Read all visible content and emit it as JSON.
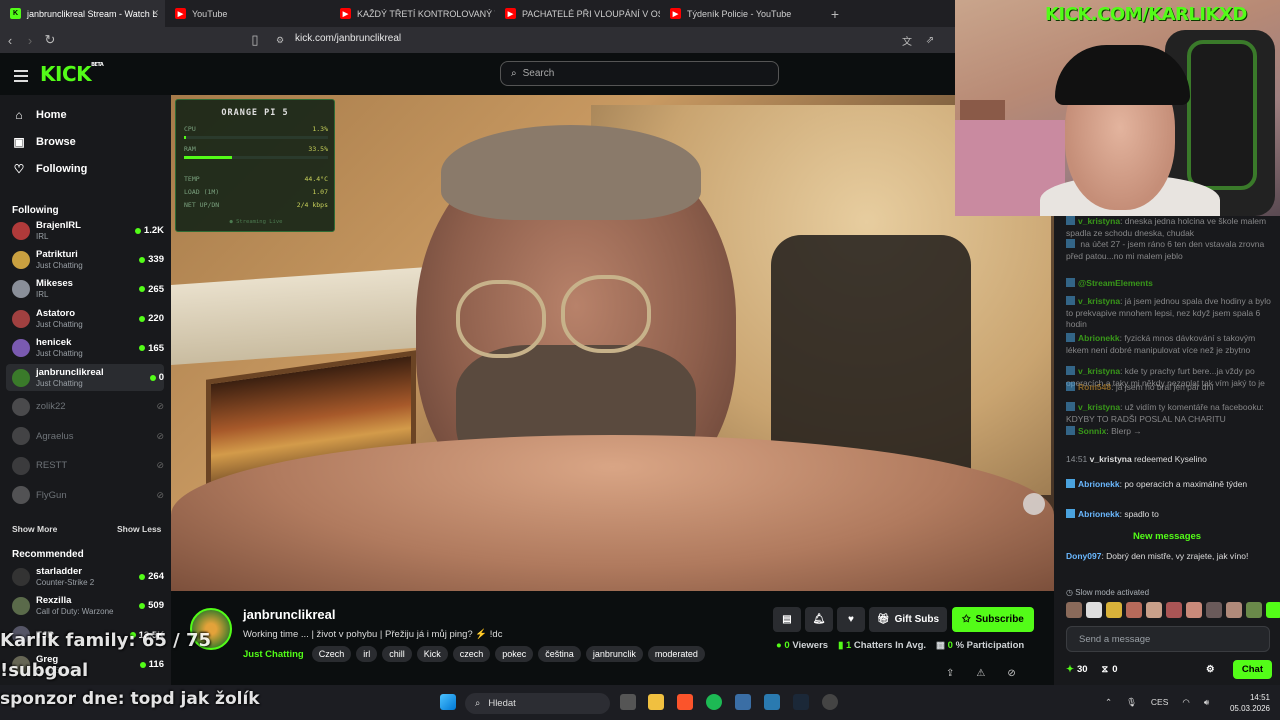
{
  "browser": {
    "tabs": [
      {
        "label": "janbrunclikreal Stream - Watch L",
        "active": true,
        "favicon": "K",
        "color": "#53fc18"
      },
      {
        "label": "YouTube",
        "active": false,
        "favicon": "▶",
        "color": "#ff0000"
      },
      {
        "label": "KAŽDÝ TŘETÍ KONTROLOVANÝ TAXI",
        "active": false,
        "favicon": "▶",
        "color": "#ff0000"
      },
      {
        "label": "PACHATELÉ PŘI VLOUPÁNÍ V OSTRAV",
        "active": false,
        "favicon": "▶",
        "color": "#ff0000"
      },
      {
        "label": "Týdeník Policie - YouTube",
        "active": false,
        "favicon": "▶",
        "color": "#ff0000"
      }
    ],
    "new_tab": "+",
    "url": "kick.com/janbrunclikreal"
  },
  "header": {
    "logo": "KICK",
    "logo_badge": "BETA",
    "search_placeholder": "Search"
  },
  "sidebar": {
    "nav": [
      {
        "label": "Home",
        "icon": "home-icon"
      },
      {
        "label": "Browse",
        "icon": "browse-icon"
      },
      {
        "label": "Following",
        "icon": "heart-icon"
      }
    ],
    "following_title": "Following",
    "following": [
      {
        "name": "BrajenIRL",
        "category": "IRL",
        "viewers": "1.2K",
        "live": true,
        "color": "#b03a3a"
      },
      {
        "name": "Patrikturi",
        "category": "Just Chatting",
        "viewers": "339",
        "live": true,
        "color": "#c9a040"
      },
      {
        "name": "Mikeses",
        "category": "IRL",
        "viewers": "265",
        "live": true,
        "color": "#8a8f99"
      },
      {
        "name": "Astatoro",
        "category": "Just Chatting",
        "viewers": "220",
        "live": true,
        "color": "#a04040"
      },
      {
        "name": "henicek",
        "category": "Just Chatting",
        "viewers": "165",
        "live": true,
        "color": "#7a5ab0"
      },
      {
        "name": "janbrunclikreal",
        "category": "Just Chatting",
        "viewers": "0",
        "live": true,
        "color": "#3a7a2a",
        "selected": true
      },
      {
        "name": "zolik22",
        "category": "",
        "viewers": "",
        "live": false,
        "color": "#888"
      },
      {
        "name": "Agraelus",
        "category": "",
        "viewers": "",
        "live": false,
        "color": "#777"
      },
      {
        "name": "RESTT",
        "category": "",
        "viewers": "",
        "live": false,
        "color": "#666"
      },
      {
        "name": "FlyGun",
        "category": "",
        "viewers": "",
        "live": false,
        "color": "#999"
      }
    ],
    "show_more": "Show More",
    "show_less": "Show Less",
    "recommended_title": "Recommended",
    "recommended": [
      {
        "name": "starladder",
        "category": "Counter-Strike 2",
        "viewers": "264",
        "color": "#333"
      },
      {
        "name": "Rexzilla",
        "category": "Call of Duty: Warzone",
        "viewers": "509",
        "color": "#5a6a4a"
      },
      {
        "name": "TJR",
        "category": "",
        "viewers": "13.5K",
        "color": "#556"
      },
      {
        "name": "Greg",
        "category": "RuneScape",
        "viewers": "116",
        "color": "#665"
      }
    ]
  },
  "overlay_monitor": {
    "title": "ORANGE PI 5",
    "rows": [
      {
        "label": "CPU",
        "value": "1.3%"
      },
      {
        "label": "RAM",
        "value": "33.5%"
      },
      {
        "label": "TEMP",
        "value": "44.4°C"
      },
      {
        "label": "LOAD (1M)",
        "value": "1.07"
      },
      {
        "label": "NET UP/DN",
        "value": "2/4 kbps"
      }
    ],
    "cpu_level": 0.013,
    "ram_level": 0.335,
    "footer": "● Streaming Live"
  },
  "webcam_tag": "KICK.COM/KARLIKXD",
  "chat": {
    "lines": [
      {
        "user": "v_kristyna",
        "text": "dneska jedna holcina ve škole malem spadla ze schodu dneska, chudak",
        "ghost": true,
        "color": "#53fc18"
      },
      {
        "user": "",
        "text": "na účet 27 - jsem ráno 6 ten den vstavala zrovna před patou...no mi malem jeblo",
        "ghost": true,
        "color": "#ddd"
      },
      {
        "user": "@StreamElements",
        "text": "",
        "ghost": true,
        "color": "#53fc18"
      },
      {
        "user": "v_kristyna",
        "text": "já jsem jednou spala dve hodiny a bylo to prekvapive mnohem lepsi, nez když jsem spala 6 hodin",
        "ghost": true,
        "color": "#53fc18"
      },
      {
        "user": "Abrionekk",
        "text": "fyzická mnos dávkování s takovým lékem není dobré manipulovat více než je zbytno",
        "ghost": true,
        "color": "#53fc18"
      },
      {
        "user": "v_kristyna",
        "text": "kde ty prachy furt bere...ja vždy po operacích a taky mi někdy nezaplat tak vím jaký to je",
        "ghost": true,
        "color": "#53fc18"
      },
      {
        "user": "Rom548",
        "text": "já jsem ho bral jen pár dní",
        "ghost": true,
        "color": "#e0a030"
      },
      {
        "user": "v_kristyna",
        "text": "už vidím ty komentáře na facebooku: KDYBY TO RADŠI POSLAL NA CHARITU",
        "ghost": true,
        "color": "#53fc18"
      },
      {
        "user": "Sonnix",
        "text": "Blerp →",
        "ghost": true,
        "color": "#53fc18"
      },
      {
        "user": "v_kristyna",
        "text": "redeemed Kyselino",
        "ghost": false,
        "color": "#dddddd",
        "ts": "14:51"
      },
      {
        "user": "Abrionekk",
        "text": "po operacích a maximálně týden",
        "ghost": false,
        "color": "#6ab8ff"
      },
      {
        "user": "Abrionekk",
        "text": "spadlo to",
        "ghost": false,
        "color": "#6ab8ff"
      }
    ],
    "new_messages": "New messages",
    "highlight": {
      "user": "Dony097",
      "text": "Dobrý den mistře, vy zrajete, jak víno!",
      "color": "#6ab8ff"
    },
    "slow_mode": "Slow mode activated",
    "input_placeholder": "Send a message",
    "points": "30",
    "other_count": "0",
    "chat_button": "Chat"
  },
  "stream": {
    "channel": "janbrunclikreal",
    "title": "Working time ... | život v pohybu | Přežiju já i můj ping? ⚡ !dc",
    "category": "Just Chatting",
    "tags": [
      "Czech",
      "irl",
      "chill",
      "Kick",
      "czech",
      "pokec",
      "čeština",
      "janbrunclik",
      "moderated"
    ],
    "gift_subs": "Gift Subs",
    "subscribe": "Subscribe",
    "viewers": "0",
    "viewers_label": "Viewers",
    "chatters": "1",
    "chatters_label": "Chatters In Avg.",
    "participation": "0",
    "participation_label": "% Participation"
  },
  "overlay_text": {
    "family": "Karlik family: 65 / 75",
    "subgoal": "!subgoal",
    "sponsor": "sponzor dne: topd jak žolík"
  },
  "taskbar": {
    "search": "Hledat",
    "lang": "CES",
    "time": "14:51",
    "date": "05.03.2026"
  }
}
